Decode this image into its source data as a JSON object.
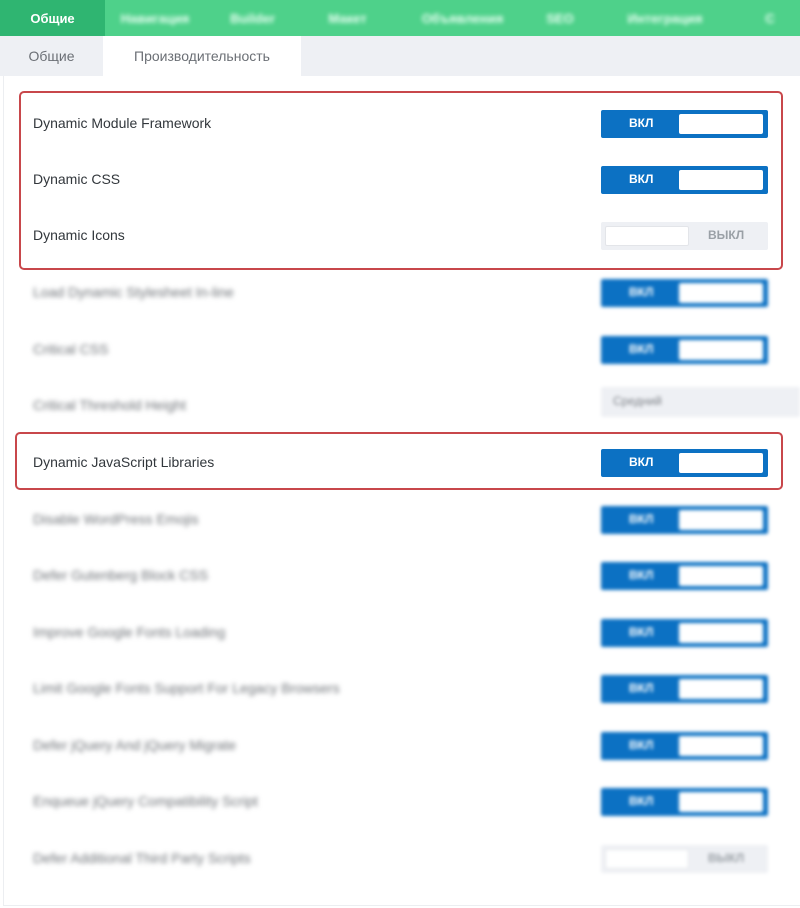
{
  "tabs": [
    {
      "label": "Общие",
      "active": true
    },
    {
      "label": "Навигация"
    },
    {
      "label": "Builder"
    },
    {
      "label": "Макет"
    },
    {
      "label": "Объявления"
    },
    {
      "label": "SEO"
    },
    {
      "label": "Интеграция"
    },
    {
      "label": "С"
    }
  ],
  "sub_tabs": [
    {
      "label": "Общие",
      "active": false
    },
    {
      "label": "Производительность",
      "active": true
    }
  ],
  "toggle_on_label": "ВКЛ",
  "toggle_off_label": "ВЫКЛ",
  "settings": [
    {
      "label": "Dynamic Module Framework",
      "type": "toggle",
      "value": true,
      "highlighted": true
    },
    {
      "label": "Dynamic CSS",
      "type": "toggle",
      "value": true,
      "highlighted": true
    },
    {
      "label": "Dynamic Icons",
      "type": "toggle",
      "value": false,
      "highlighted": true
    },
    {
      "label": "Load Dynamic Stylesheet In-line",
      "type": "toggle",
      "value": true,
      "blurred": true
    },
    {
      "label": "Critical CSS",
      "type": "toggle",
      "value": true,
      "blurred": true
    },
    {
      "label": "Critical Threshold Height",
      "type": "select",
      "value": "Средний",
      "blurred": true
    },
    {
      "label": "Dynamic JavaScript Libraries",
      "type": "toggle",
      "value": true,
      "highlighted": true
    },
    {
      "label": "Disable WordPress Emojis",
      "type": "toggle",
      "value": true,
      "blurred": true
    },
    {
      "label": "Defer Gutenberg Block CSS",
      "type": "toggle",
      "value": true,
      "blurred": true
    },
    {
      "label": "Improve Google Fonts Loading",
      "type": "toggle",
      "value": true,
      "blurred": true
    },
    {
      "label": "Limit Google Fonts Support For Legacy Browsers",
      "type": "toggle",
      "value": true,
      "blurred": true
    },
    {
      "label": "Defer jQuery And jQuery Migrate",
      "type": "toggle",
      "value": true,
      "blurred": true
    },
    {
      "label": "Enqueue jQuery Compatibility Script",
      "type": "toggle",
      "value": true,
      "blurred": true
    },
    {
      "label": "Defer Additional Third Party Scripts",
      "type": "toggle",
      "value": false,
      "blurred": true
    }
  ],
  "colors": {
    "tab_bar": "#4ed18a",
    "tab_active": "#2fb571",
    "toggle_on": "#0c71c3",
    "highlight_border": "#c8474b"
  }
}
